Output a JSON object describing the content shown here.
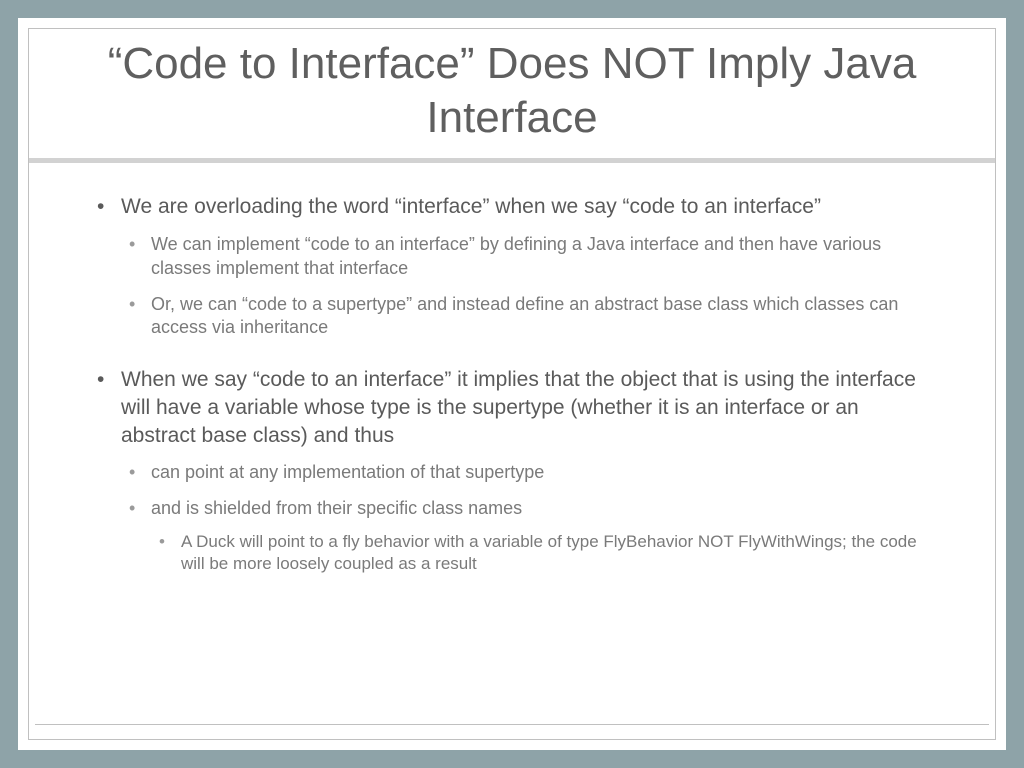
{
  "title": "“Code to Interface” Does NOT Imply Java Interface",
  "bullets": [
    {
      "text": "We are overloading the word “interface” when we say “code to an interface”",
      "children": [
        {
          "text": "We can implement “code to an interface” by defining a Java interface and then have various classes implement that interface"
        },
        {
          "text": "Or, we can “code to a supertype” and instead define an abstract base class which classes can access via inheritance"
        }
      ]
    },
    {
      "text": "When we say “code to an interface” it implies that the object that is using the interface will have a variable whose type is the supertype (whether it is an interface or an abstract base class) and thus",
      "children": [
        {
          "text": "can point at any implementation of that supertype"
        },
        {
          "text": "and is shielded from their specific class names",
          "children": [
            {
              "text": "A Duck will point to a fly behavior with a variable of type FlyBehavior NOT FlyWithWings; the code will be more loosely coupled as a result"
            }
          ]
        }
      ]
    }
  ]
}
